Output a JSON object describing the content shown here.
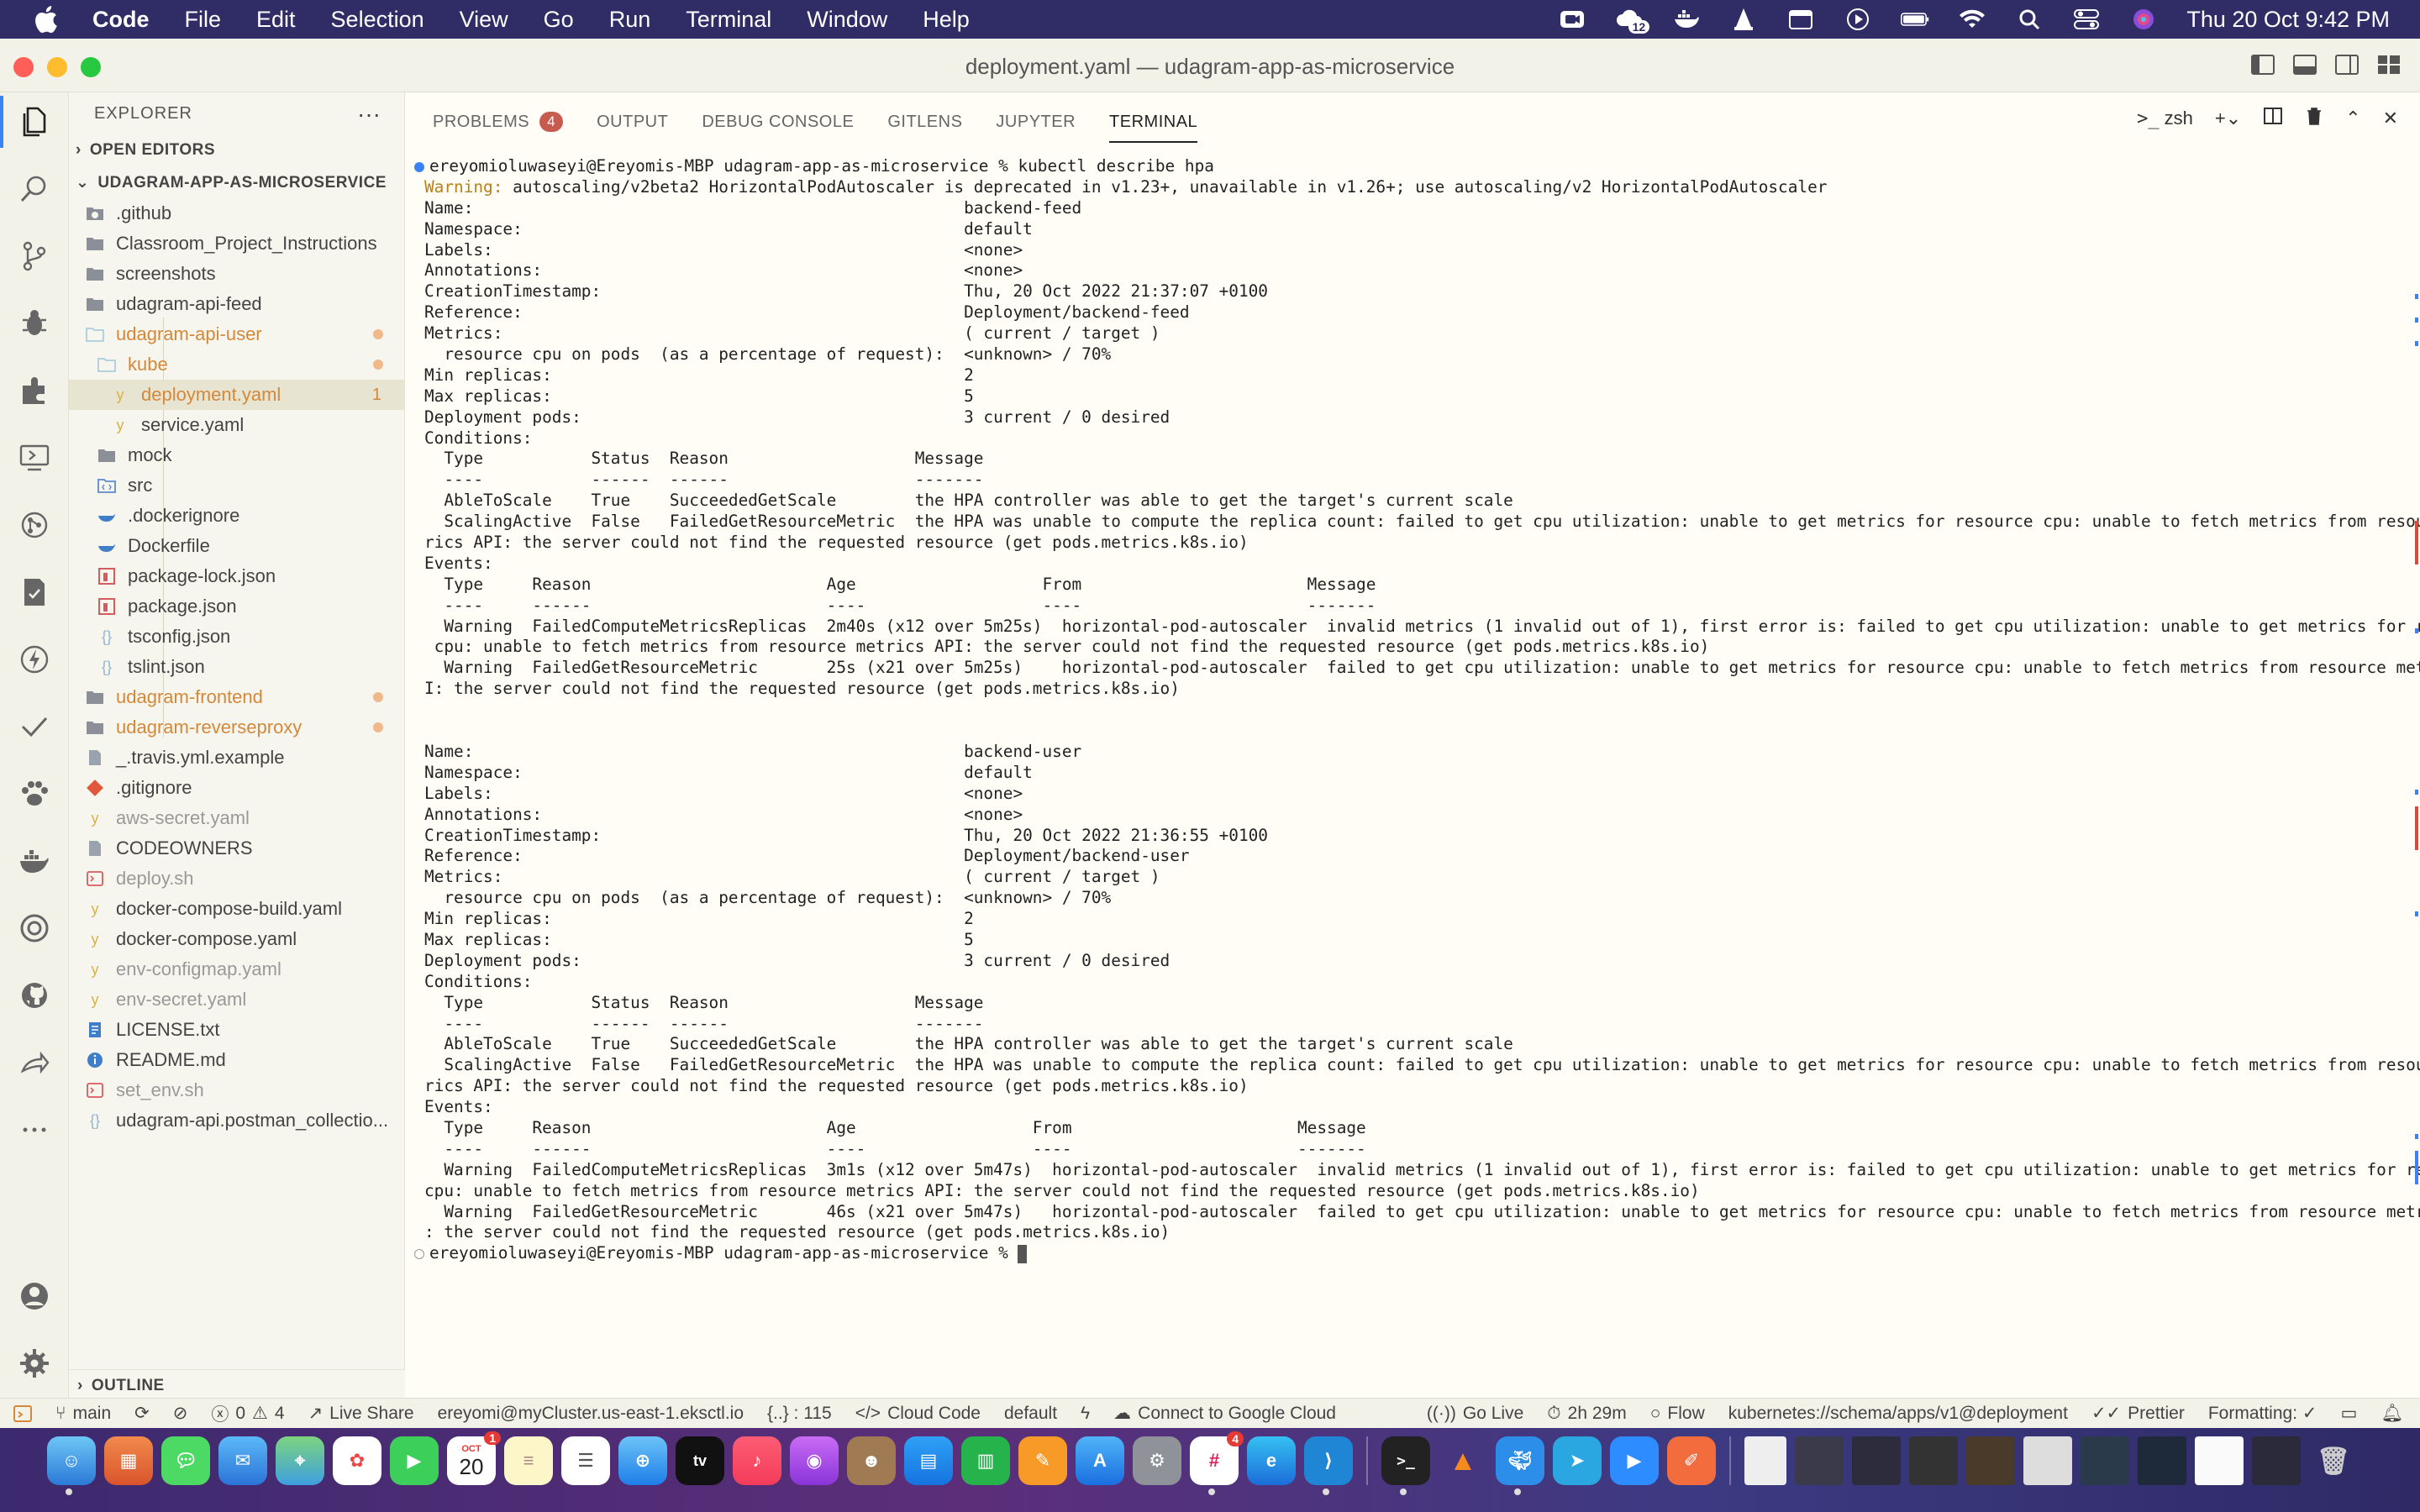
{
  "menubar": {
    "app_name": "Code",
    "items": [
      "File",
      "Edit",
      "Selection",
      "View",
      "Go",
      "Run",
      "Terminal",
      "Window",
      "Help"
    ],
    "badge_count": "12",
    "datetime": "Thu 20 Oct  9:42 PM"
  },
  "window": {
    "title": "deployment.yaml — udagram-app-as-microservice"
  },
  "explorer": {
    "header": "EXPLORER",
    "open_editors": "OPEN EDITORS",
    "root": "UDAGRAM-APP-AS-MICROSERVICE",
    "outline": "OUTLINE",
    "items": [
      {
        "label": ".github",
        "type": "folder-special"
      },
      {
        "label": "Classroom_Project_Instructions",
        "type": "folder"
      },
      {
        "label": "screenshots",
        "type": "folder"
      },
      {
        "label": "udagram-api-feed",
        "type": "folder"
      },
      {
        "label": "udagram-api-user",
        "type": "folder-open"
      },
      {
        "label": "kube",
        "type": "folder-open"
      },
      {
        "label": "deployment.yaml",
        "type": "yaml",
        "count": "1"
      },
      {
        "label": "service.yaml",
        "type": "yaml"
      },
      {
        "label": "mock",
        "type": "folder"
      },
      {
        "label": "src",
        "type": "folder-special"
      },
      {
        "label": ".dockerignore",
        "type": "docker"
      },
      {
        "label": "Dockerfile",
        "type": "docker"
      },
      {
        "label": "package-lock.json",
        "type": "npm"
      },
      {
        "label": "package.json",
        "type": "npm"
      },
      {
        "label": "tsconfig.json",
        "type": "json"
      },
      {
        "label": "tslint.json",
        "type": "json"
      },
      {
        "label": "udagram-frontend",
        "type": "folder"
      },
      {
        "label": "udagram-reverseproxy",
        "type": "folder"
      },
      {
        "label": "_.travis.yml.example",
        "type": "file"
      },
      {
        "label": ".gitignore",
        "type": "git"
      },
      {
        "label": "aws-secret.yaml",
        "type": "yaml"
      },
      {
        "label": "CODEOWNERS",
        "type": "file"
      },
      {
        "label": "deploy.sh",
        "type": "shell"
      },
      {
        "label": "docker-compose-build.yaml",
        "type": "yaml"
      },
      {
        "label": "docker-compose.yaml",
        "type": "yaml"
      },
      {
        "label": "env-configmap.yaml",
        "type": "yaml"
      },
      {
        "label": "env-secret.yaml",
        "type": "yaml"
      },
      {
        "label": "LICENSE.txt",
        "type": "license"
      },
      {
        "label": "README.md",
        "type": "info"
      },
      {
        "label": "set_env.sh",
        "type": "shell"
      },
      {
        "label": "udagram-api.postman_collectio...",
        "type": "json"
      }
    ]
  },
  "panel": {
    "tabs": {
      "problems": "PROBLEMS",
      "problems_count": "4",
      "output": "OUTPUT",
      "debug_console": "DEBUG CONSOLE",
      "gitlens": "GITLENS",
      "jupyter": "JUPYTER",
      "terminal": "TERMINAL"
    },
    "shell": "zsh"
  },
  "terminal": {
    "lines": [
      {
        "text": "ereyomioluwaseyi@Ereyomis-MBP udagram-app-as-microservice % kubectl describe hpa",
        "kind": "prompt-blue"
      },
      {
        "text": "Warning:",
        "rest": " autoscaling/v2beta2 HorizontalPodAutoscaler is deprecated in v1.23+, unavailable in v1.26+; use autoscaling/v2 HorizontalPodAutoscaler",
        "kind": "warning"
      },
      {
        "text": "Name:                                                  backend-feed"
      },
      {
        "text": "Namespace:                                             default"
      },
      {
        "text": "Labels:                                                <none>"
      },
      {
        "text": "Annotations:                                           <none>"
      },
      {
        "text": "CreationTimestamp:                                     Thu, 20 Oct 2022 21:37:07 +0100"
      },
      {
        "text": "Reference:                                             Deployment/backend-feed"
      },
      {
        "text": "Metrics:                                               ( current / target )"
      },
      {
        "text": "  resource cpu on pods  (as a percentage of request):  <unknown> / 70%"
      },
      {
        "text": "Min replicas:                                          2"
      },
      {
        "text": "Max replicas:                                          5"
      },
      {
        "text": "Deployment pods:                                       3 current / 0 desired"
      },
      {
        "text": "Conditions:"
      },
      {
        "text": "  Type           Status  Reason                   Message"
      },
      {
        "text": "  ----           ------  ------                   -------"
      },
      {
        "text": "  AbleToScale    True    SucceededGetScale        the HPA controller was able to get the target's current scale"
      },
      {
        "text": "  ScalingActive  False   FailedGetResourceMetric  the HPA was unable to compute the replica count: failed to get cpu utilization: unable to get metrics for resource cpu: unable to fetch metrics from resource met"
      },
      {
        "text": "rics API: the server could not find the requested resource (get pods.metrics.k8s.io)"
      },
      {
        "text": "Events:"
      },
      {
        "text": "  Type     Reason                        Age                   From                       Message"
      },
      {
        "text": "  ----     ------                        ----                  ----                       -------"
      },
      {
        "text": "  Warning  FailedComputeMetricsReplicas  2m40s (x12 over 5m25s)  horizontal-pod-autoscaler  invalid metrics (1 invalid out of 1), first error is: failed to get cpu utilization: unable to get metrics for resource"
      },
      {
        "text": " cpu: unable to fetch metrics from resource metrics API: the server could not find the requested resource (get pods.metrics.k8s.io)"
      },
      {
        "text": "  Warning  FailedGetResourceMetric       25s (x21 over 5m25s)    horizontal-pod-autoscaler  failed to get cpu utilization: unable to get metrics for resource cpu: unable to fetch metrics from resource metrics AP"
      },
      {
        "text": "I: the server could not find the requested resource (get pods.metrics.k8s.io)"
      },
      {
        "text": ""
      },
      {
        "text": ""
      },
      {
        "text": "Name:                                                  backend-user"
      },
      {
        "text": "Namespace:                                             default"
      },
      {
        "text": "Labels:                                                <none>"
      },
      {
        "text": "Annotations:                                           <none>"
      },
      {
        "text": "CreationTimestamp:                                     Thu, 20 Oct 2022 21:36:55 +0100"
      },
      {
        "text": "Reference:                                             Deployment/backend-user"
      },
      {
        "text": "Metrics:                                               ( current / target )"
      },
      {
        "text": "  resource cpu on pods  (as a percentage of request):  <unknown> / 70%"
      },
      {
        "text": "Min replicas:                                          2"
      },
      {
        "text": "Max replicas:                                          5"
      },
      {
        "text": "Deployment pods:                                       3 current / 0 desired"
      },
      {
        "text": "Conditions:"
      },
      {
        "text": "  Type           Status  Reason                   Message"
      },
      {
        "text": "  ----           ------  ------                   -------"
      },
      {
        "text": "  AbleToScale    True    SucceededGetScale        the HPA controller was able to get the target's current scale"
      },
      {
        "text": "  ScalingActive  False   FailedGetResourceMetric  the HPA was unable to compute the replica count: failed to get cpu utilization: unable to get metrics for resource cpu: unable to fetch metrics from resource met"
      },
      {
        "text": "rics API: the server could not find the requested resource (get pods.metrics.k8s.io)"
      },
      {
        "text": "Events:"
      },
      {
        "text": "  Type     Reason                        Age                  From                       Message"
      },
      {
        "text": "  ----     ------                        ----                 ----                       -------"
      },
      {
        "text": "  Warning  FailedComputeMetricsReplicas  3m1s (x12 over 5m47s)  horizontal-pod-autoscaler  invalid metrics (1 invalid out of 1), first error is: failed to get cpu utilization: unable to get metrics for resource"
      },
      {
        "text": "cpu: unable to fetch metrics from resource metrics API: the server could not find the requested resource (get pods.metrics.k8s.io)"
      },
      {
        "text": "  Warning  FailedGetResourceMetric       46s (x21 over 5m47s)   horizontal-pod-autoscaler  failed to get cpu utilization: unable to get metrics for resource cpu: unable to fetch metrics from resource metrics API"
      },
      {
        "text": ": the server could not find the requested resource (get pods.metrics.k8s.io)"
      },
      {
        "text": "ereyomioluwaseyi@Ereyomis-MBP udagram-app-as-microservice % ",
        "kind": "prompt-empty"
      }
    ]
  },
  "statusbar": {
    "branch": "main",
    "errors": "0",
    "warnings": "4",
    "live_share": "Live Share",
    "cluster": "ereyomi@myCluster.us-east-1.eksctl.io",
    "position": "{..} : 115",
    "cloud_code": "Cloud Code",
    "namespace": "default",
    "google_cloud": "Connect to Google Cloud",
    "go_live": "Go Live",
    "time": "2h 29m",
    "flow": "Flow",
    "schema": "kubernetes://schema/apps/v1@deployment",
    "prettier": "Prettier",
    "formatting": "Formatting: ✓"
  },
  "dock": {
    "calendar_month": "OCT",
    "calendar_day": "20",
    "calendar_badge": "1",
    "slack_badge": "4"
  },
  "colors": {
    "menubar_bg": "#302c66",
    "accent": "#3b82f6",
    "modified": "#d4883a",
    "warning": "#b9801b"
  }
}
